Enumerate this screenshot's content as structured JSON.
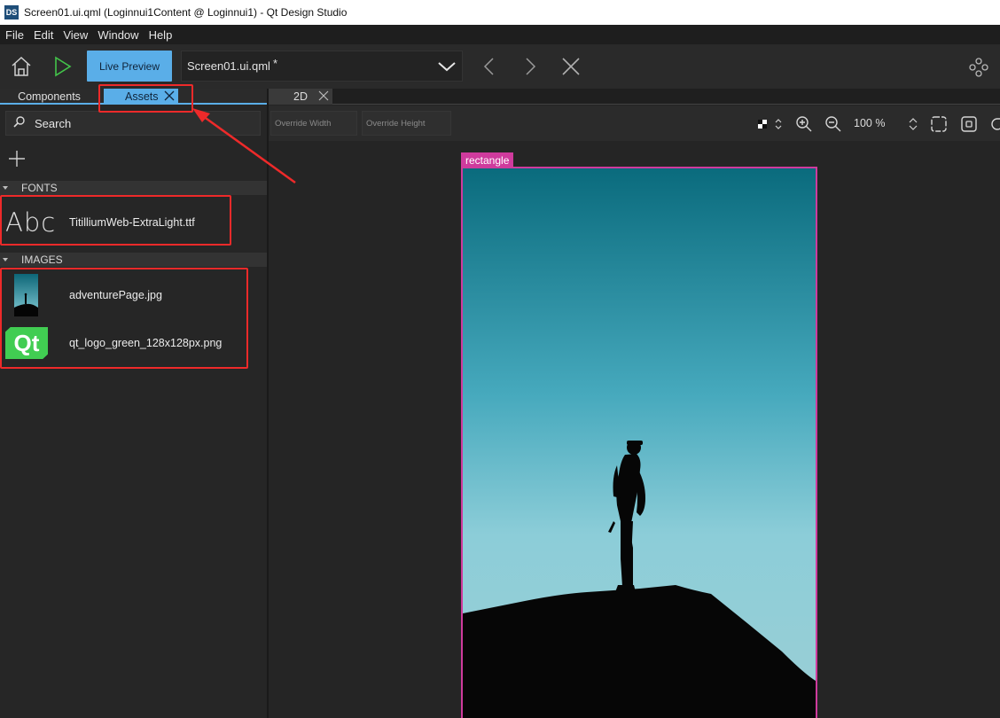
{
  "window": {
    "app_icon_text": "DS",
    "title": "Screen01.ui.qml (Loginnui1Content @ Loginnui1) - Qt Design Studio"
  },
  "menu": [
    {
      "label": "File"
    },
    {
      "label": "Edit"
    },
    {
      "label": "View"
    },
    {
      "label": "Window"
    },
    {
      "label": "Help"
    }
  ],
  "toolbar": {
    "live_preview_label": "Live Preview",
    "current_file": "Screen01.ui.qml",
    "modified_marker": "*"
  },
  "left_panel": {
    "tabs": [
      {
        "label": "Components"
      },
      {
        "label": "Assets",
        "active": true
      }
    ],
    "search": {
      "placeholder": "Search"
    },
    "sections": [
      {
        "label": "FONTS",
        "items": [
          {
            "thumb_text": "Abc",
            "name": "TitilliumWeb-ExtraLight.ttf"
          }
        ]
      },
      {
        "label": "IMAGES",
        "items": [
          {
            "name": "adventurePage.jpg"
          },
          {
            "thumb_text": "Qt",
            "name": "qt_logo_green_128x128px.png"
          }
        ]
      }
    ]
  },
  "editor": {
    "tab_label": "2D",
    "override_width_placeholder": "Override Width",
    "override_height_placeholder": "Override Height",
    "zoom": "100 %",
    "selected_item_label": "rectangle"
  },
  "colors": {
    "accent": "#5aaee8",
    "selection": "#cf3b9d",
    "annotation": "#ee2a2a",
    "qt_green": "#41cd52"
  }
}
